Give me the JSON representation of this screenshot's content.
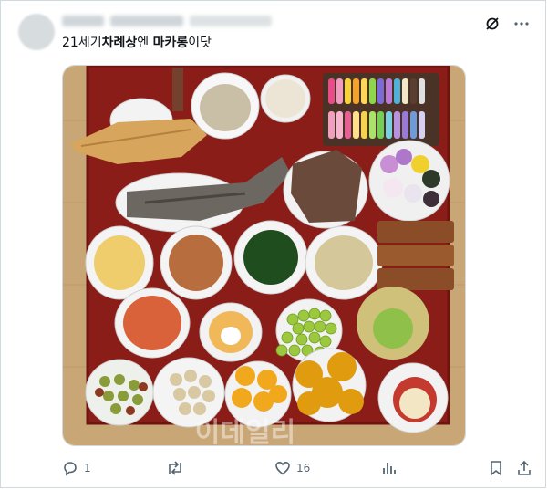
{
  "post": {
    "text_pre": "21세기",
    "text_bold1": "차례상",
    "text_mid": "엔 ",
    "text_bold2": "마카롱",
    "text_post": "이닷"
  },
  "image": {
    "watermark": "이데일리"
  },
  "actions": {
    "reply_count": "1",
    "repost_count": "",
    "like_count": "16"
  },
  "icons": {
    "grok": "grok-icon",
    "more": "more-icon",
    "reply": "reply-icon",
    "repost": "repost-icon",
    "like": "like-icon",
    "views": "views-icon",
    "bookmark": "bookmark-icon",
    "share": "share-icon"
  },
  "colors": {
    "text": "#0f1419",
    "muted": "#536471",
    "border": "#cfd9de",
    "table": "#8b1d18"
  }
}
